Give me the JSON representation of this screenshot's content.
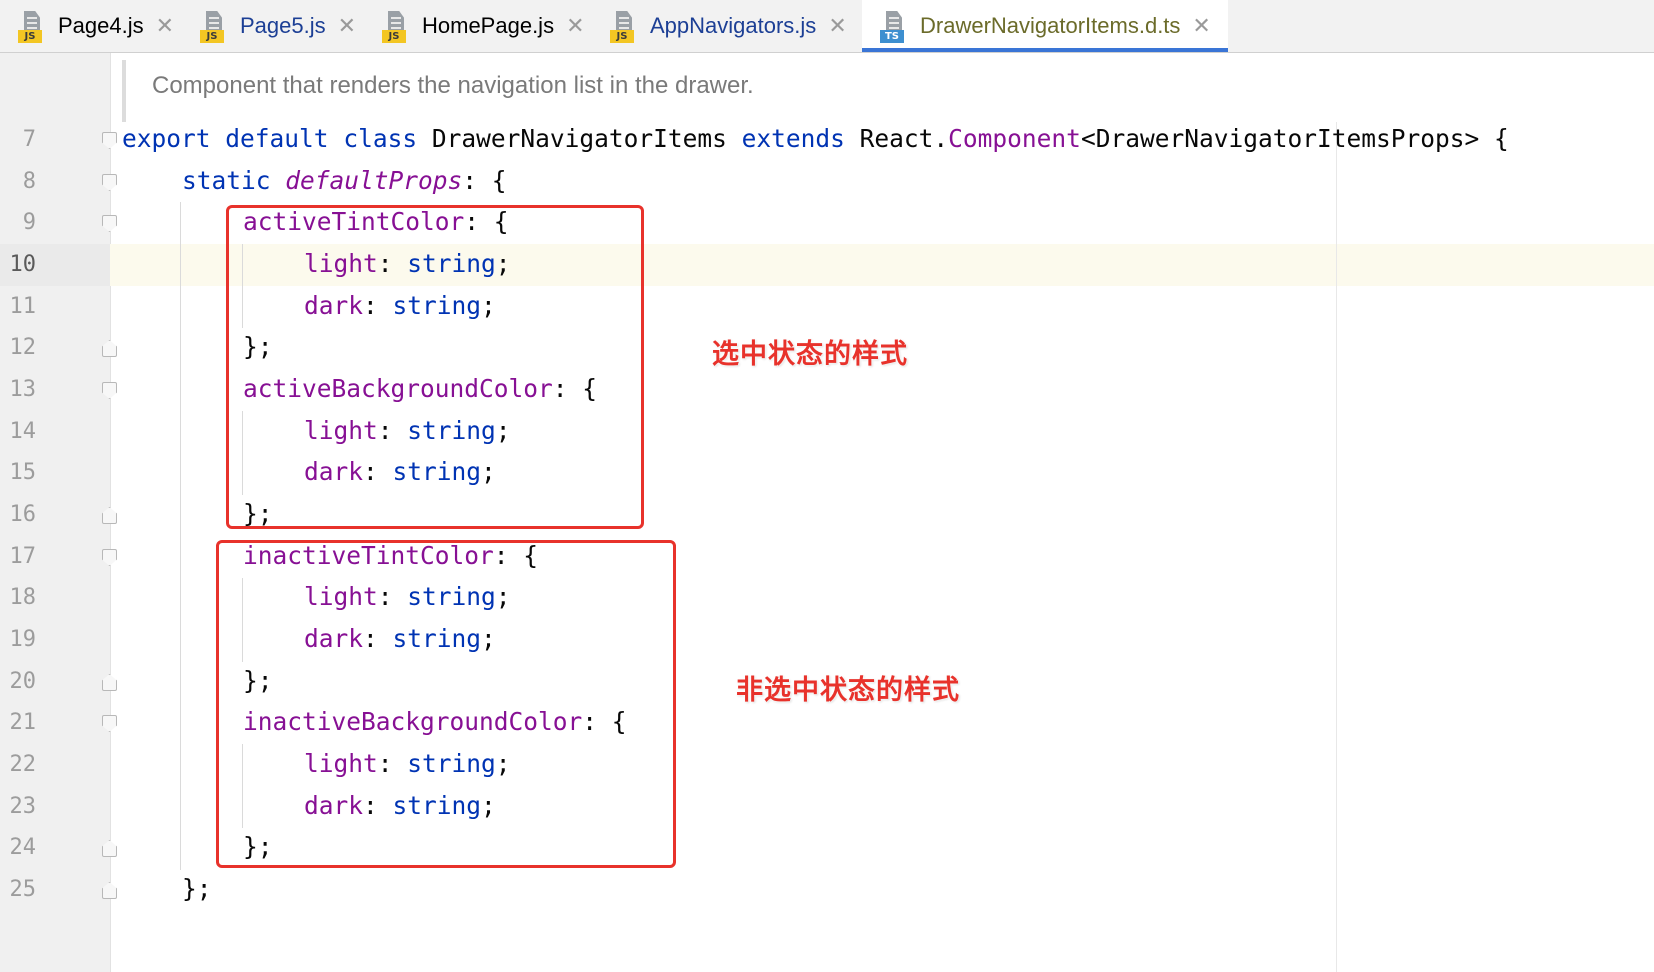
{
  "tabs": [
    {
      "name": "Page4.js",
      "icon": "js",
      "color": "#000000",
      "active": false
    },
    {
      "name": "Page5.js",
      "icon": "js",
      "color": "#1c3f95",
      "active": false
    },
    {
      "name": "HomePage.js",
      "icon": "js",
      "color": "#000000",
      "active": false
    },
    {
      "name": "AppNavigators.js",
      "icon": "js",
      "color": "#1c3f95",
      "active": false
    },
    {
      "name": "DrawerNavigatorItems.d.ts",
      "icon": "ts",
      "color": "#6b6b2a",
      "active": true
    }
  ],
  "close_glyph": "✕",
  "doc_comment": "Component that renders the navigation list in the drawer.",
  "code": {
    "l7": {
      "num": "7",
      "t1": "export",
      "t2": "default",
      "t3": "class",
      "t4": "DrawerNavigatorItems",
      "t5": "extends",
      "t6": "React.",
      "t7": "Component",
      "t8": "<DrawerNavigatorItemsProps> {"
    },
    "l8": {
      "num": "8",
      "t1": "static",
      "t2": "defaultProps",
      "t3": ": {"
    },
    "l9": {
      "num": "9",
      "t1": "activeTintColor",
      "t2": ": {"
    },
    "l10": {
      "num": "10",
      "t1": "light",
      "t2": ": ",
      "t3": "string",
      "t4": ";"
    },
    "l11": {
      "num": "11",
      "t1": "dark",
      "t2": ": ",
      "t3": "string",
      "t4": ";"
    },
    "l12": {
      "num": "12",
      "t1": "};"
    },
    "l13": {
      "num": "13",
      "t1": "activeBackgroundColor",
      "t2": ": {"
    },
    "l14": {
      "num": "14",
      "t1": "light",
      "t2": ": ",
      "t3": "string",
      "t4": ";"
    },
    "l15": {
      "num": "15",
      "t1": "dark",
      "t2": ": ",
      "t3": "string",
      "t4": ";"
    },
    "l16": {
      "num": "16",
      "t1": "};"
    },
    "l17": {
      "num": "17",
      "t1": "inactiveTintColor",
      "t2": ": {"
    },
    "l18": {
      "num": "18",
      "t1": "light",
      "t2": ": ",
      "t3": "string",
      "t4": ";"
    },
    "l19": {
      "num": "19",
      "t1": "dark",
      "t2": ": ",
      "t3": "string",
      "t4": ";"
    },
    "l20": {
      "num": "20",
      "t1": "};"
    },
    "l21": {
      "num": "21",
      "t1": "inactiveBackgroundColor",
      "t2": ": {"
    },
    "l22": {
      "num": "22",
      "t1": "light",
      "t2": ": ",
      "t3": "string",
      "t4": ";"
    },
    "l23": {
      "num": "23",
      "t1": "dark",
      "t2": ": ",
      "t3": "string",
      "t4": ";"
    },
    "l24": {
      "num": "24",
      "t1": "};"
    },
    "l25": {
      "num": "25",
      "t1": "};"
    }
  },
  "annotations": {
    "active_label": "选中状态的样式",
    "inactive_label": "非选中状态的样式"
  },
  "colors": {
    "keyword": "#0033b3",
    "property": "#871094",
    "annotation": "#e8322b",
    "current_line": "#fcfaed",
    "tab_underline": "#3a75d6"
  }
}
